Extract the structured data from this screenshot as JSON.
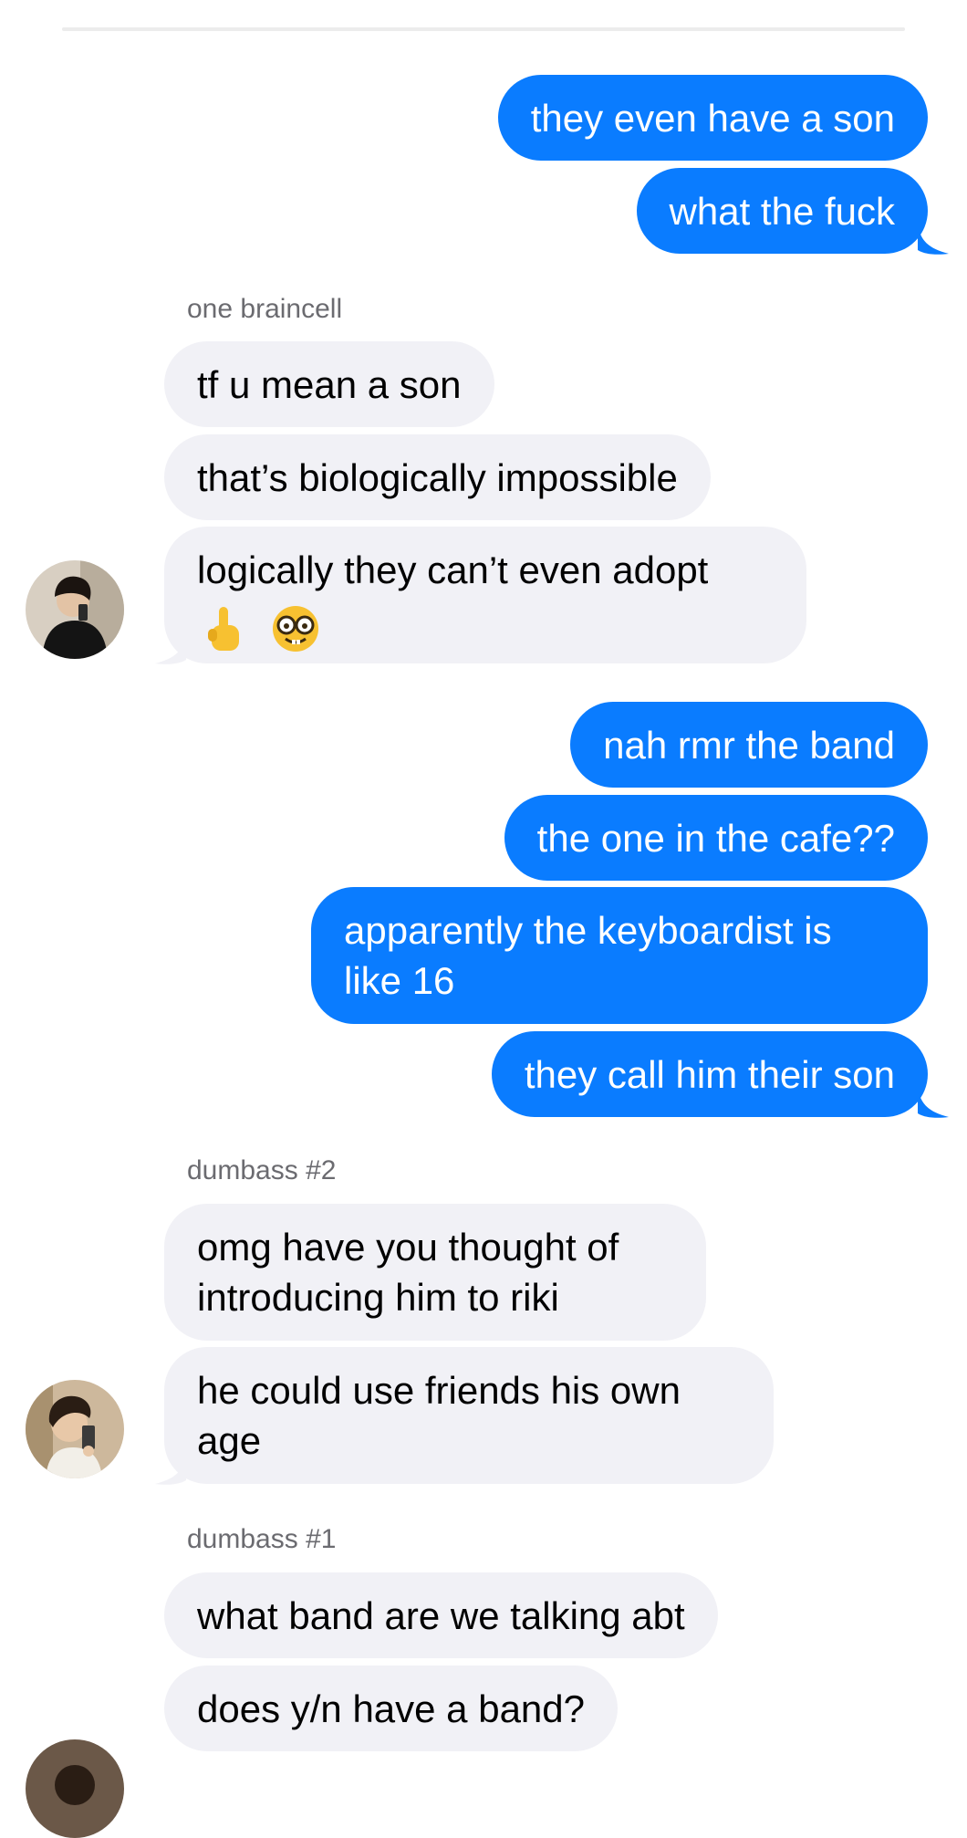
{
  "messages": {
    "m1": "they even have a son",
    "m2": "what the fuck",
    "m3": "tf u mean a son",
    "m4": "that’s biologically impossible",
    "m5": "logically they can’t even adopt",
    "m6": "nah rmr the band",
    "m7": "the one in the cafe??",
    "m8": "apparently the keyboardist is like 16",
    "m9": "they call him their son",
    "m10": "omg have you thought of introducing him to riki",
    "m11": "he could use friends his own age",
    "m12": "what band are we talking abt",
    "m13": "does y/n have a band?"
  },
  "senders": {
    "s1": "one braincell",
    "s2": "dumbass #2",
    "s3": "dumbass #1"
  },
  "emojis": [
    "pointing-up-emoji",
    "nerd-face-emoji"
  ],
  "colors": {
    "sent_bubble": "#0a7cff",
    "received_bubble": "#f1f1f6",
    "sender_label": "#6b6b70"
  }
}
